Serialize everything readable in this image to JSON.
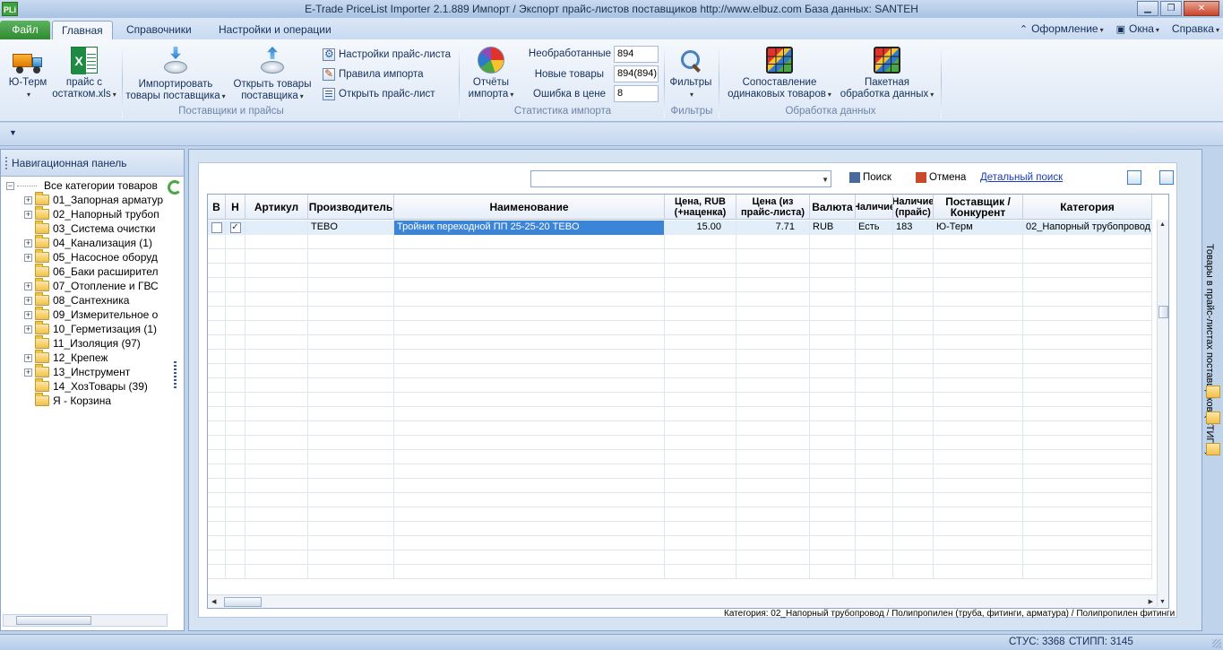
{
  "window": {
    "title": "E-Trade PriceList Importer 2.1.889     Импорт / Экспорт прайс-листов поставщиков     http://www.elbuz.com     База данных: SANTEH",
    "icon_text": "PLi",
    "controls": [
      "minimize",
      "restore",
      "close"
    ]
  },
  "ribbon_tabs": {
    "file": "Файл",
    "tabs": [
      "Главная",
      "Справочники",
      "Настройки и операции"
    ],
    "active": "Главная",
    "right_menus": [
      "Оформление",
      "Окна",
      "Справка"
    ]
  },
  "ribbon": {
    "group_suppliers": {
      "label": "Поставщики и прайсы",
      "yu_term": "Ю-Терм",
      "price_xls_1": "прайс с",
      "price_xls_2": "остатком.xls",
      "import_1": "Импортировать",
      "import_2": "товары поставщика",
      "open_1": "Открыть товары",
      "open_2": "поставщика",
      "settings": "Настройки прайс-листа",
      "rules": "Правила импорта",
      "open_price": "Открыть прайс-лист"
    },
    "group_stats": {
      "label": "Статистика импорта",
      "reports_1": "Отчёты",
      "reports_2": "импорта",
      "unprocessed_label": "Необработанные",
      "unprocessed_value": "894",
      "new_label": "Новые товары",
      "new_value": "894(894)",
      "price_error_label": "Ошибка в цене",
      "price_error_value": "8"
    },
    "group_filters": {
      "label": "Фильтры",
      "filters": "Фильтры"
    },
    "group_processing": {
      "label": "Обработка данных",
      "compare_1": "Сопоставление",
      "compare_2": "одинаковых товаров",
      "batch_1": "Пакетная",
      "batch_2": "обработка данных"
    }
  },
  "nav": {
    "title": "Навигационная панель",
    "root": "Все категории товаров",
    "items": [
      {
        "label": "01_Запорная арматур",
        "expandable": true
      },
      {
        "label": "02_Напорный трубоп",
        "expandable": true
      },
      {
        "label": "03_Система очистки",
        "expandable": false
      },
      {
        "label": "04_Канализация (1)",
        "expandable": true
      },
      {
        "label": "05_Насосное оборуд",
        "expandable": true
      },
      {
        "label": "06_Баки расширител",
        "expandable": false
      },
      {
        "label": "07_Отопление и ГВС",
        "expandable": true
      },
      {
        "label": "08_Сантехника",
        "expandable": true
      },
      {
        "label": "09_Измерительное о",
        "expandable": true
      },
      {
        "label": "10_Герметизация (1)",
        "expandable": true
      },
      {
        "label": "11_Изоляция (97)",
        "expandable": false
      },
      {
        "label": "12_Крепеж",
        "expandable": true
      },
      {
        "label": "13_Инструмент",
        "expandable": true
      },
      {
        "label": "14_ХозТовары (39)",
        "expandable": false
      },
      {
        "label": "Я - Корзина",
        "expandable": false
      }
    ]
  },
  "toolbar": {
    "search_placeholder": "",
    "search_button": "Поиск",
    "cancel_button": "Отмена",
    "advanced_search": "Детальный поиск"
  },
  "grid": {
    "columns": [
      "В",
      "Н",
      "Артикул",
      "Производитель",
      "Наименование",
      "Цена, RUB (+наценка)",
      "Цена (из прайс-листа)",
      "Валюта",
      "Наличие",
      "Наличие (прайс)",
      "Поставщик / Конкурент",
      "Категория"
    ],
    "rows": [
      {
        "v_checked": false,
        "n_checked": true,
        "article": "",
        "manufacturer": "TEBO",
        "name": "Тройник переходной ПП 25-25-20 TEBO",
        "price_markup": "15.00",
        "price_list": "7.71",
        "currency": "RUB",
        "availability": "Есть",
        "availability_price": "183",
        "supplier": "Ю-Терм",
        "category": "02_Напорный трубопровод"
      }
    ],
    "empty_rows": 24
  },
  "category_path": "Категория: 02_Напорный трубопровод / Полипропилен (труба, фитинги, арматура) / Полипропилен фитинги",
  "side_panel_title": "Товары в прайс-листах поставщиков (СТИПП)",
  "status": {
    "stus": "СТУС: 3368",
    "stipp": "СТИПП: 3145"
  }
}
